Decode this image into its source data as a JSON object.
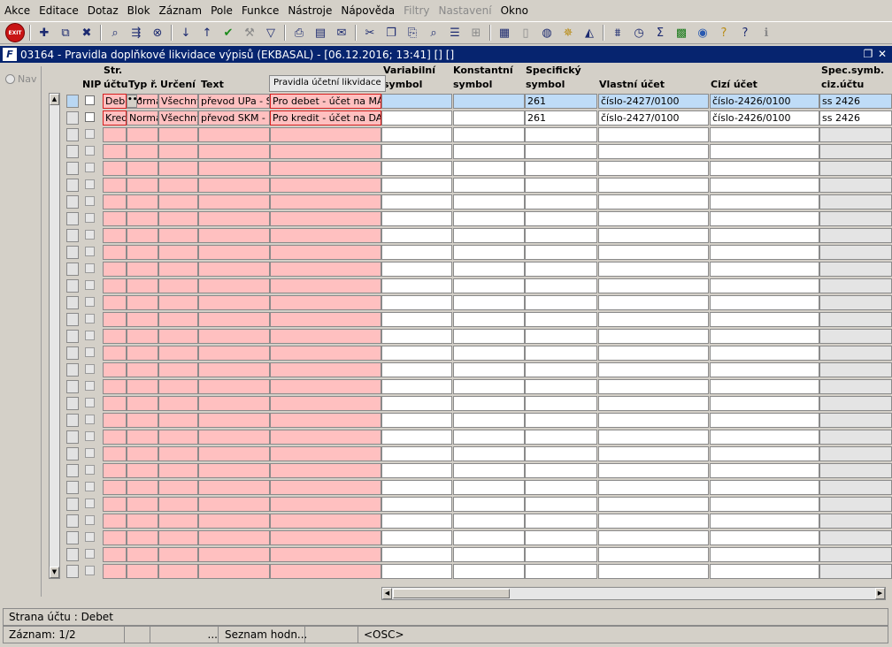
{
  "menu": [
    "Akce",
    "Editace",
    "Dotaz",
    "Blok",
    "Záznam",
    "Pole",
    "Funkce",
    "Nástroje",
    "Nápověda",
    "Filtry",
    "Nastavení",
    "Okno"
  ],
  "toolbar": {
    "exit_label": "EXIT"
  },
  "window": {
    "title": "03164 - Pravidla doplňkové likvidace výpisů (EKBASAL) - [06.12.2016; 13:41]  []  []"
  },
  "nav": {
    "label": "Nav"
  },
  "columns": {
    "nip": "NIP",
    "str_line1": "Str.",
    "str_line2": "účtu",
    "typ": "Typ ř.",
    "urceni": "Určení",
    "text": "Text",
    "var_line1": "Variabilní",
    "var_line2": "symbol",
    "konst_line1": "Konstantní",
    "konst_line2": "symbol",
    "spec_line1": "Specifický",
    "spec_line2": "symbol",
    "vlastni": "Vlastní účet",
    "cizi": "Cizí účet",
    "specciz_line1": "Spec.symb.",
    "specciz_line2": "ciz.účtu"
  },
  "tooltip": "Pravidla účetní likvidace",
  "rows": [
    {
      "strana": "Debet",
      "typ": "Normá",
      "urceni": "Všechny",
      "text": "převod UPa - Sl",
      "popis": "Pro debet - účet na MÁ D",
      "var": "",
      "konst": "",
      "spec": "261",
      "vlastni": "číslo-2427/0100",
      "cizi": "číslo-2426/0100",
      "specciz": "ss 2426"
    },
    {
      "strana": "Kredit",
      "typ": "Normá",
      "urceni": "Všechny",
      "text": "převod SKM - U",
      "popis": "Pro kredit - účet na DAL:",
      "var": "",
      "konst": "",
      "spec": "261",
      "vlastni": "číslo-2427/0100",
      "cizi": "číslo-2426/0100",
      "specciz": "ss 2426"
    }
  ],
  "status": {
    "line1": "Strana účtu : Debet",
    "record": "Záznam: 1/2",
    "dots": "...",
    "list": "Seznam hodn...",
    "osc": "<OSC>"
  }
}
